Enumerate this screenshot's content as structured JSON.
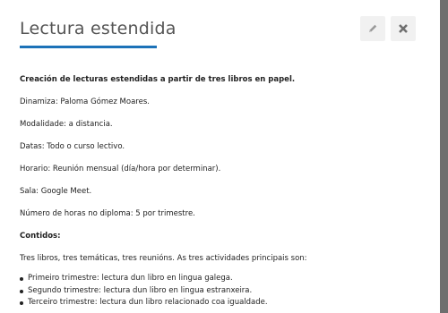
{
  "modal": {
    "title": "Lectura estendida",
    "edit_icon": "pencil-icon",
    "close_icon": "close-icon",
    "colors": {
      "accent": "#1c72b8",
      "title": "#555555",
      "overlay": "#7d7d7d",
      "icon_button_bg": "#f1f1f1"
    }
  },
  "content": {
    "intro": "Creación de lecturas estendidas a partir de tres libros en papel.",
    "dinamiza": "Dinamiza: Paloma Gómez Moares.",
    "modalidade": "Modalidade: a distancia.",
    "datas": "Datas: Todo o curso lectivo.",
    "horario": "Horario: Reunión mensual (día/hora por determinar).",
    "sala": "Sala: Google Meet.",
    "horas": "Número de horas no diploma: 5 por trimestre.",
    "contidos_heading": "Contidos:",
    "contidos_text": "Tres libros, tres temáticas, tres reunións. As tres actividades principais son:",
    "bullets": [
      "Primeiro trimestre: lectura dun libro en lingua galega.",
      "Segundo trimestre: lectura dun libro en lingua estranxeira.",
      "Terceiro trimestre: lectura dun libro relacionado coa igualdade."
    ]
  }
}
